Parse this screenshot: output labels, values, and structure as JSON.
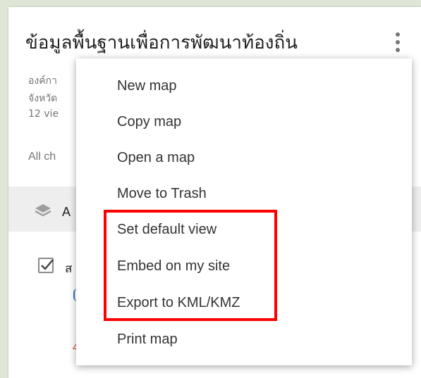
{
  "map": {
    "title": "ข้อมูลพื้นฐานเพื่อการพัฒนาท้องถิ่น",
    "description_line1": "องค์กา",
    "description_line2": "จังหวัด",
    "views": "12 vie",
    "changes": "All ch",
    "layer_header_label": "A",
    "layer_label": "ส",
    "layer_checked": true,
    "red_fragment": "4"
  },
  "menu": {
    "items": [
      {
        "label": "New map"
      },
      {
        "label": "Copy map"
      },
      {
        "label": "Open a map"
      },
      {
        "label": "Move to Trash"
      },
      {
        "label": "Set default view"
      },
      {
        "label": "Embed on my site"
      },
      {
        "label": "Export to KML/KMZ"
      },
      {
        "label": "Print map"
      }
    ]
  },
  "colors": {
    "highlight_border": "#ff0000",
    "layer_header_bg": "#eeeeee",
    "map_bg": "#e9ede3"
  },
  "icons": {
    "more": "more-vert-icon",
    "layers": "layers-icon",
    "checkbox": "checkbox-checked-icon"
  }
}
